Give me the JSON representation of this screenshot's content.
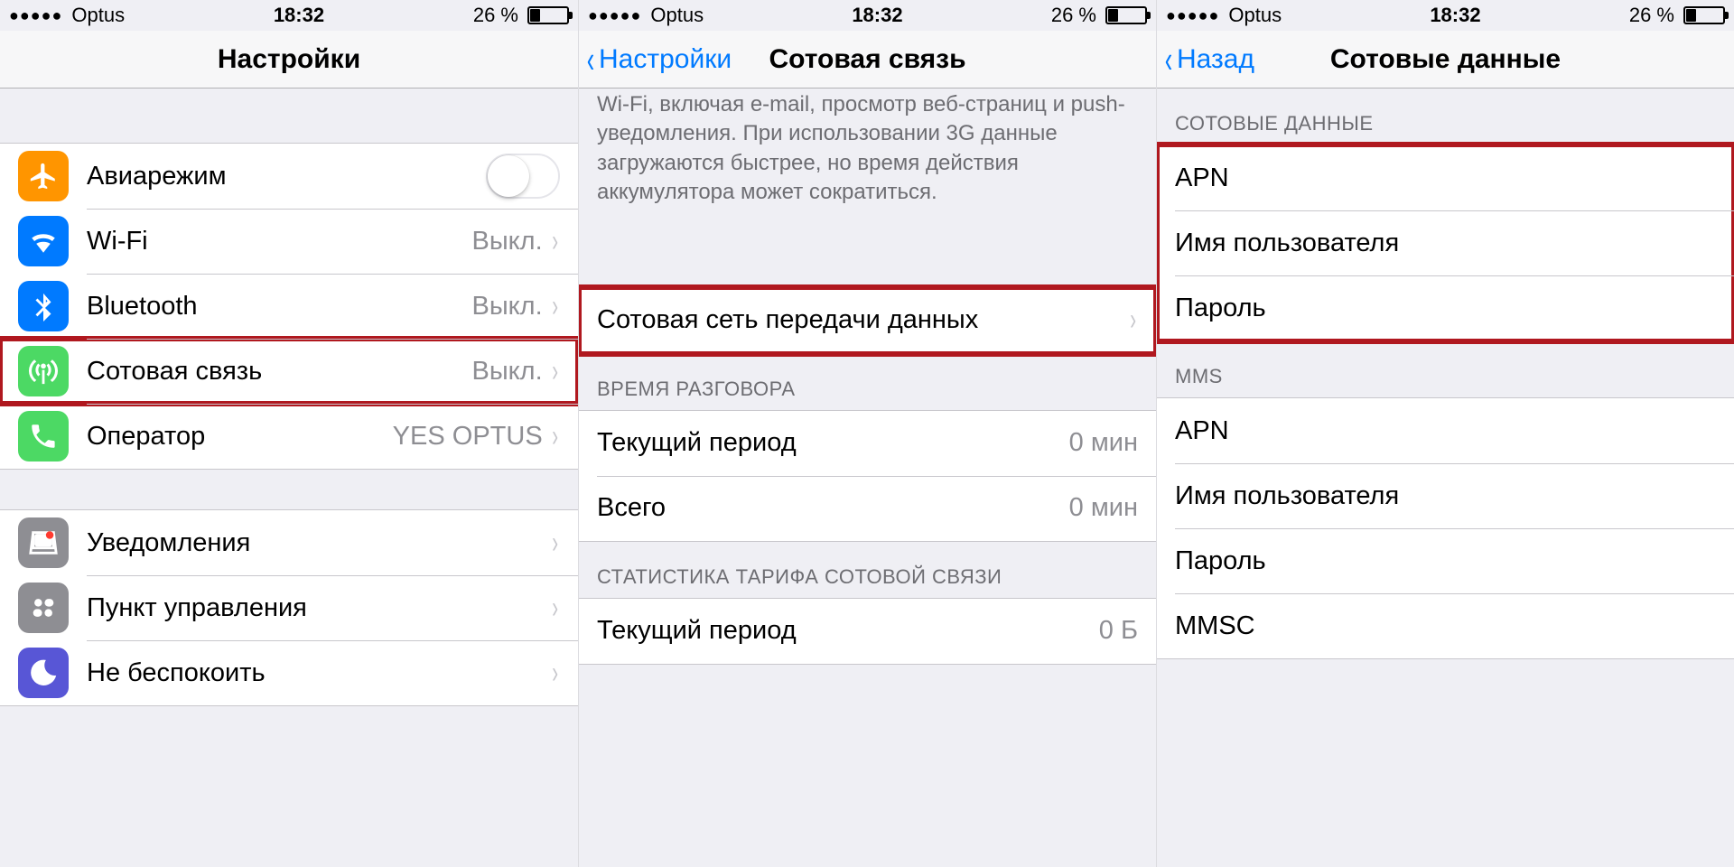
{
  "status": {
    "signal": "●●●●●",
    "carrier": "Optus",
    "time": "18:32",
    "battery_pct": "26 %"
  },
  "screen1": {
    "title": "Настройки",
    "items": {
      "airplane": {
        "label": "Авиарежим"
      },
      "wifi": {
        "label": "Wi-Fi",
        "value": "Выкл."
      },
      "bluetooth": {
        "label": "Bluetooth",
        "value": "Выкл."
      },
      "cellular": {
        "label": "Сотовая связь",
        "value": "Выкл."
      },
      "carrier": {
        "label": "Оператор",
        "value": "YES OPTUS"
      },
      "notif": {
        "label": "Уведомления"
      },
      "control": {
        "label": "Пункт управления"
      },
      "dnd": {
        "label": "Не беспокоить"
      }
    }
  },
  "screen2": {
    "back": "Настройки",
    "title": "Сотовая связь",
    "blurb": "Wi-Fi, включая e-mail, просмотр веб-страниц и push-уведомления. При использовании 3G данные загружаются быстрее, но время действия аккумулятора может сократиться.",
    "data_network_label": "Сотовая сеть передачи данных",
    "section_call_time": "ВРЕМЯ РАЗГОВОРА",
    "call_current": {
      "label": "Текущий период",
      "value": "0 мин"
    },
    "call_total": {
      "label": "Всего",
      "value": "0 мин"
    },
    "section_stats": "СТАТИСТИКА ТАРИФА СОТОВОЙ СВЯЗИ",
    "stats_current": {
      "label": "Текущий период",
      "value": "0 Б"
    }
  },
  "screen3": {
    "back": "Назад",
    "title": "Сотовые данные",
    "section_cellular": "СОТОВЫЕ ДАННЫЕ",
    "cellular": {
      "apn": "APN",
      "user": "Имя пользователя",
      "pass": "Пароль"
    },
    "section_mms": "MMS",
    "mms": {
      "apn": "APN",
      "user": "Имя пользователя",
      "pass": "Пароль",
      "mmsc": "MMSC"
    }
  }
}
